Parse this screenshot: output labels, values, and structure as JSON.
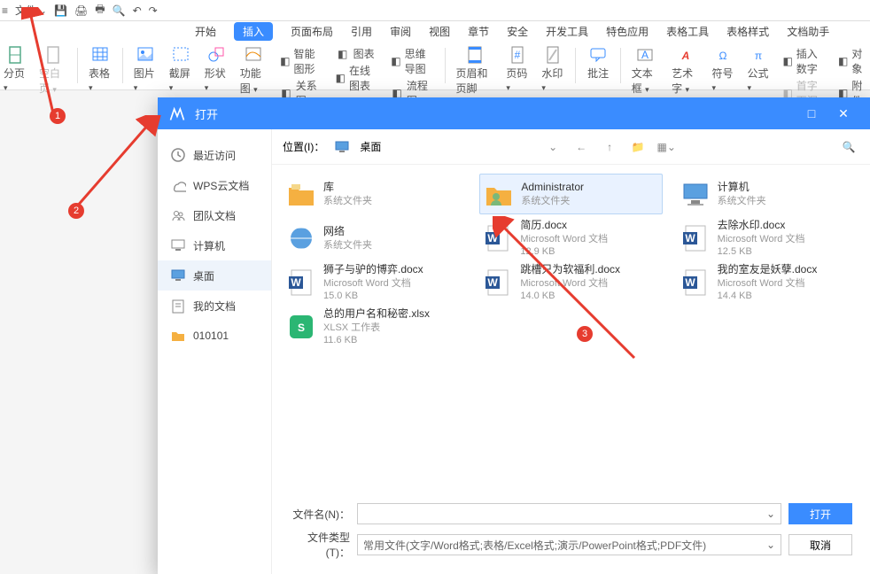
{
  "topbar": {
    "file_menu": "文件"
  },
  "menu": {
    "items": [
      "开始",
      "插入",
      "页面布局",
      "引用",
      "审阅",
      "视图",
      "章节",
      "安全",
      "开发工具",
      "特色应用",
      "表格工具",
      "表格样式",
      "文档助手"
    ],
    "active_index": 1
  },
  "ribbon": {
    "big": [
      {
        "name": "page",
        "label": "分页",
        "drop": true
      },
      {
        "name": "blank",
        "label": "空白页",
        "drop": true,
        "gray": true
      },
      {
        "name": "table",
        "label": "表格",
        "drop": true
      },
      {
        "name": "picture",
        "label": "图片",
        "drop": true
      },
      {
        "name": "screenshot",
        "label": "截屏",
        "drop": true
      },
      {
        "name": "shapes",
        "label": "形状",
        "drop": true
      },
      {
        "name": "functionchart",
        "label": "功能图",
        "drop": true
      }
    ],
    "col1": [
      {
        "name": "smart",
        "label": "智能图形"
      },
      {
        "name": "relation",
        "label": "关系图"
      }
    ],
    "col2": [
      {
        "name": "chart",
        "label": "图表"
      },
      {
        "name": "onlinechart",
        "label": "在线图表"
      }
    ],
    "col3": [
      {
        "name": "mindmap",
        "label": "思维导图"
      },
      {
        "name": "flowchart",
        "label": "流程图"
      }
    ],
    "big2": [
      {
        "name": "headerfooter",
        "label": "页眉和页脚"
      },
      {
        "name": "pagenum",
        "label": "页码",
        "drop": true
      },
      {
        "name": "watermark",
        "label": "水印",
        "drop": true
      },
      {
        "name": "comment",
        "label": "批注"
      },
      {
        "name": "textbox",
        "label": "文本框",
        "drop": true
      },
      {
        "name": "wordart",
        "label": "艺术字",
        "drop": true
      },
      {
        "name": "symbol",
        "label": "符号",
        "drop": true
      },
      {
        "name": "equation",
        "label": "公式",
        "drop": true
      }
    ],
    "col4": [
      {
        "name": "insertnum",
        "label": "插入数字"
      },
      {
        "name": "firstletter",
        "label": "首字下沉",
        "gray": true
      }
    ],
    "col5": [
      {
        "name": "object",
        "label": "对象"
      },
      {
        "name": "attach",
        "label": "附件"
      }
    ]
  },
  "dialog": {
    "title": "打开",
    "sidebar": [
      {
        "name": "recent",
        "label": "最近访问"
      },
      {
        "name": "wpscloud",
        "label": "WPS云文档"
      },
      {
        "name": "team",
        "label": "团队文档"
      },
      {
        "name": "computer",
        "label": "计算机"
      },
      {
        "name": "desktop",
        "label": "桌面"
      },
      {
        "name": "mydocs",
        "label": "我的文档"
      },
      {
        "name": "folder010101",
        "label": "010101"
      }
    ],
    "active_sidebar": 4,
    "location_label": "位置(I)：",
    "location_value": "桌面",
    "files": [
      {
        "name": "库",
        "meta": "系统文件夹",
        "type": "libfolder"
      },
      {
        "name": "Administrator",
        "meta": "系统文件夹",
        "type": "userfolder",
        "selected": true
      },
      {
        "name": "计算机",
        "meta": "系统文件夹",
        "type": "computer"
      },
      {
        "name": "网络",
        "meta": "系统文件夹",
        "type": "network"
      },
      {
        "name": "简历.docx",
        "meta": "Microsoft Word 文档",
        "size": "12.9 KB",
        "type": "docx"
      },
      {
        "name": "去除水印.docx",
        "meta": "Microsoft Word 文档",
        "size": "12.5 KB",
        "type": "docx"
      },
      {
        "name": "狮子与驴的博弈.docx",
        "meta": "Microsoft Word 文档",
        "size": "15.0 KB",
        "type": "docx"
      },
      {
        "name": "跳槽只为软福利.docx",
        "meta": "Microsoft Word 文档",
        "size": "14.0 KB",
        "type": "docx"
      },
      {
        "name": "我的室友是妖孽.docx",
        "meta": "Microsoft Word 文档",
        "size": "14.4 KB",
        "type": "docx"
      },
      {
        "name": "总的用户名和秘密.xlsx",
        "meta": "XLSX 工作表",
        "size": "11.6 KB",
        "type": "xlsx"
      }
    ],
    "filename_label": "文件名(N)：",
    "filetype_label": "文件类型(T)：",
    "filetype_value": "常用文件(文字/Word格式;表格/Excel格式;演示/PowerPoint格式;PDF文件)",
    "open_btn": "打开",
    "cancel_btn": "取消"
  },
  "markers": {
    "m1": "1",
    "m2": "2",
    "m3": "3"
  }
}
